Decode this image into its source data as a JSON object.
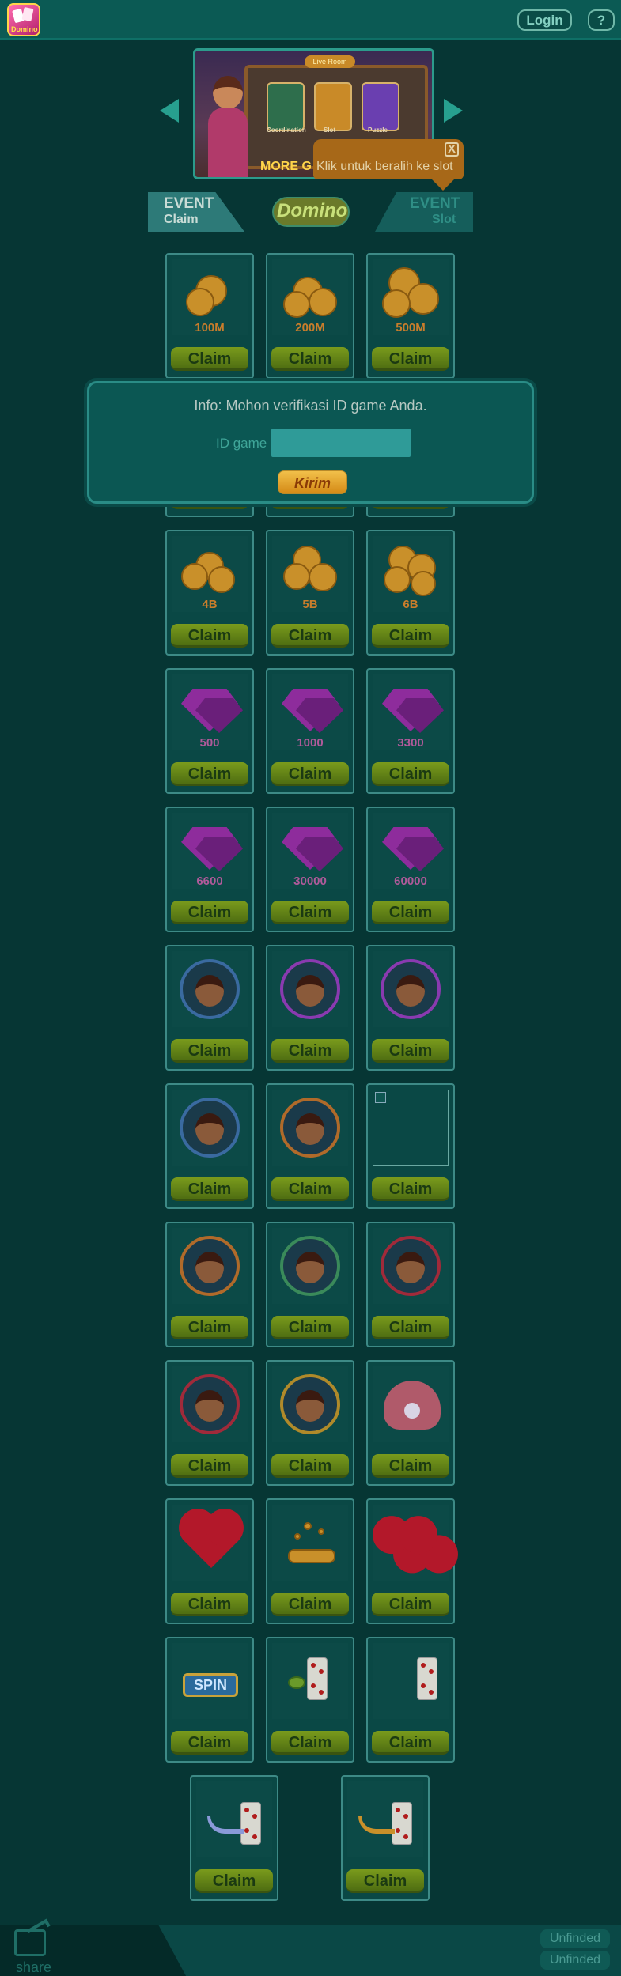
{
  "header": {
    "login_label": "Login",
    "help_label": "?"
  },
  "banner": {
    "tag_text": "Live Room",
    "card_labels": [
      "Coordination",
      "Slot",
      "Puzzle"
    ],
    "more_text": "MORE G"
  },
  "tooltip": {
    "text": "Klik untuk beralih ke slot",
    "close_label": "X"
  },
  "tabs": {
    "left": {
      "line1": "EVENT",
      "line2": "Claim"
    },
    "right": {
      "line1": "EVENT",
      "line2": "Slot"
    },
    "logo_text": "Domino"
  },
  "modal": {
    "info": "Info: Mohon verifikasi ID game Anda.",
    "id_label": "ID game",
    "id_value": "",
    "send_label": "Kirim"
  },
  "rewards": {
    "claim_label": "Claim",
    "coins_row1": [
      "100M",
      "200M",
      "500M"
    ],
    "coins_row3": [
      "4B",
      "5B",
      "6B"
    ],
    "gems_row1": [
      "500",
      "1000",
      "3300"
    ],
    "gems_row2": [
      "6600",
      "30000",
      "60000"
    ],
    "spin_label": "SPIN"
  },
  "footer": {
    "share_label": "share",
    "unfinded_1": "Unfinded",
    "unfinded_2": "Unfinded"
  },
  "colors": {
    "background": "#063634",
    "header": "#0b5a54",
    "claim_button": "#6a8b18",
    "send_button": "#e8a828",
    "tooltip": "#a76818"
  }
}
